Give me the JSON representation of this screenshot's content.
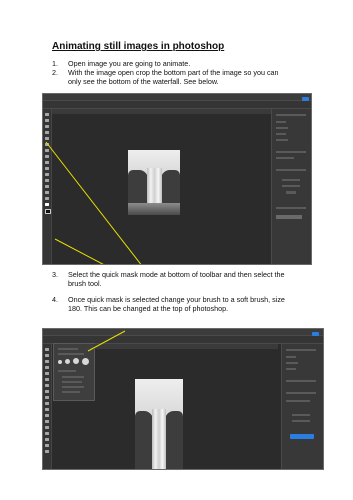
{
  "title": "Animating still images in photoshop",
  "steps": [
    {
      "num": "1.",
      "lines": [
        "Open image you are going to animate."
      ]
    },
    {
      "num": "2.",
      "lines": [
        "With the image open crop the bottom part of the image so you can",
        "only see the bottom of the waterfall. See below."
      ]
    },
    {
      "num": "3.",
      "lines": [
        "Select the quick mask mode at bottom of toolbar and then select the",
        "brush tool."
      ]
    },
    {
      "num": "4.",
      "lines": [
        "Once quick mask is selected change your brush to a soft brush, size",
        "180. This can be changed at the top of photoshop."
      ]
    }
  ],
  "screenshots": [
    {
      "name": "photoshop-crop-screenshot",
      "annotation_color": "#e8e000"
    },
    {
      "name": "photoshop-brush-screenshot",
      "annotation_color": "#e8e000"
    }
  ]
}
